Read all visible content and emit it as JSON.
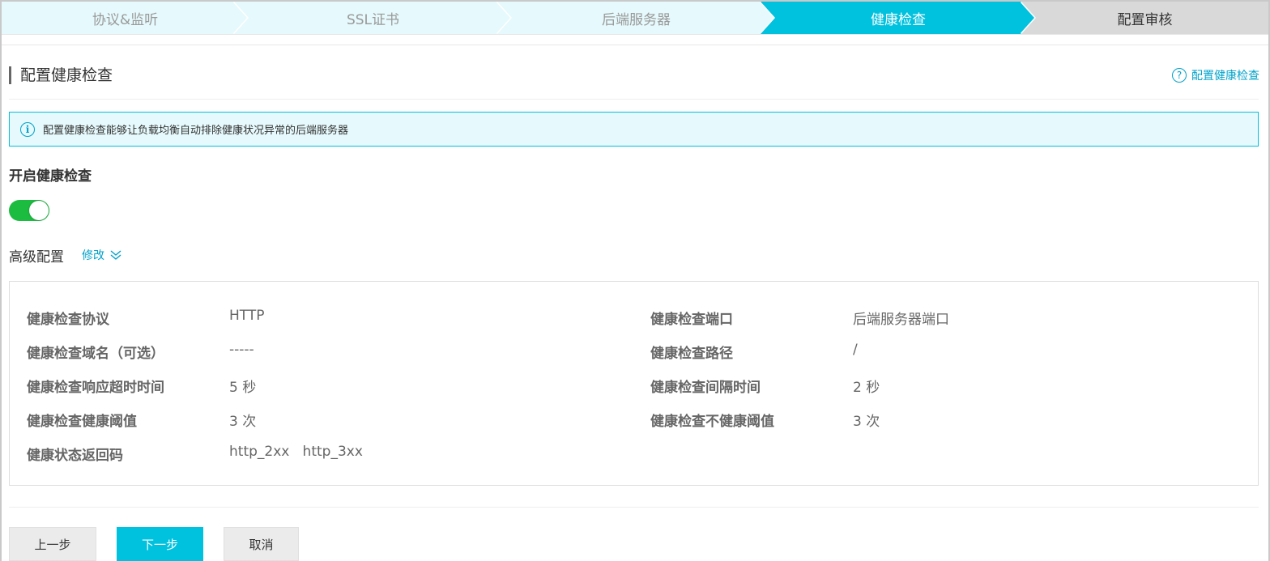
{
  "steps": [
    {
      "label": "协议&监听",
      "state": "done"
    },
    {
      "label": "SSL证书",
      "state": "done"
    },
    {
      "label": "后端服务器",
      "state": "done"
    },
    {
      "label": "健康检查",
      "state": "active"
    },
    {
      "label": "配置审核",
      "state": "pending"
    }
  ],
  "colors": {
    "accent": "#00c1de",
    "link": "#00a2ca",
    "step_done_bg": "#e6f9fc",
    "step_pending_bg": "#d9d9d9",
    "toggle_on": "#1bbc3f"
  },
  "section": {
    "title": "配置健康检查",
    "help_icon": "question-circle-icon",
    "help_link": "配置健康检查"
  },
  "info": {
    "icon": "info-circle-icon",
    "text": "配置健康检查能够让负载均衡自动排除健康状况异常的后端服务器"
  },
  "enable": {
    "label": "开启健康检查",
    "toggle_on": true
  },
  "advanced": {
    "label": "高级配置",
    "modify_link": "修改",
    "expand_icon": "double-chevron-down-icon"
  },
  "details": {
    "left": [
      {
        "label": "健康检查协议",
        "value": "HTTP"
      },
      {
        "label": "健康检查域名（可选）",
        "value": "-----"
      },
      {
        "label": "健康检查响应超时时间",
        "value": "5 秒"
      },
      {
        "label": "健康检查健康阈值",
        "value": "3 次"
      },
      {
        "label": "健康状态返回码",
        "value": "http_2xx   http_3xx"
      }
    ],
    "right": [
      {
        "label": "健康检查端口",
        "value": "后端服务器端口"
      },
      {
        "label": "健康检查路径",
        "value": "/"
      },
      {
        "label": "健康检查间隔时间",
        "value": "2 秒"
      },
      {
        "label": "健康检查不健康阈值",
        "value": "3 次"
      }
    ]
  },
  "buttons": {
    "prev": "上一步",
    "next": "下一步",
    "cancel": "取消"
  }
}
